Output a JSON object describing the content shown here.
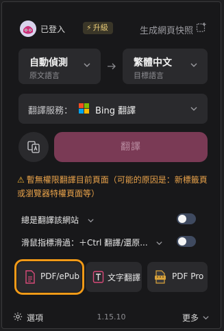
{
  "header": {
    "login_status": "已登入",
    "upgrade_label": "升級",
    "snapshot_label": "生成網頁快照"
  },
  "languages": {
    "source": {
      "name": "自動偵測",
      "caption": "原文語言"
    },
    "target": {
      "name": "繁體中文",
      "caption": "目標語言"
    }
  },
  "service": {
    "label": "翻譯服務：",
    "name": "Bing 翻譯"
  },
  "translate_button": "翻譯",
  "warning": "暫無權限翻譯目前頁面（可能的原因是：新標籤頁或瀏覽器特權頁面等）",
  "options": {
    "always_translate": "總是翻譯該網站",
    "hover_translate": "滑鼠指標滑過：＋Ctrl 翻譯/還原..."
  },
  "tools": [
    {
      "label": "PDF/ePub",
      "icon": "pdf-file-icon",
      "selected": true
    },
    {
      "label": "文字翻譯",
      "icon": "text-translate-icon"
    },
    {
      "label": "PDF Pro",
      "icon": "pdf-pro-icon"
    }
  ],
  "footer": {
    "settings_label": "選項",
    "version": "1.15.10",
    "more_label": "更多"
  },
  "colors": {
    "accent": "#7a3a55",
    "warning": "#e8a24a",
    "highlight": "#f29a17",
    "upgrade": "#e7c976"
  }
}
